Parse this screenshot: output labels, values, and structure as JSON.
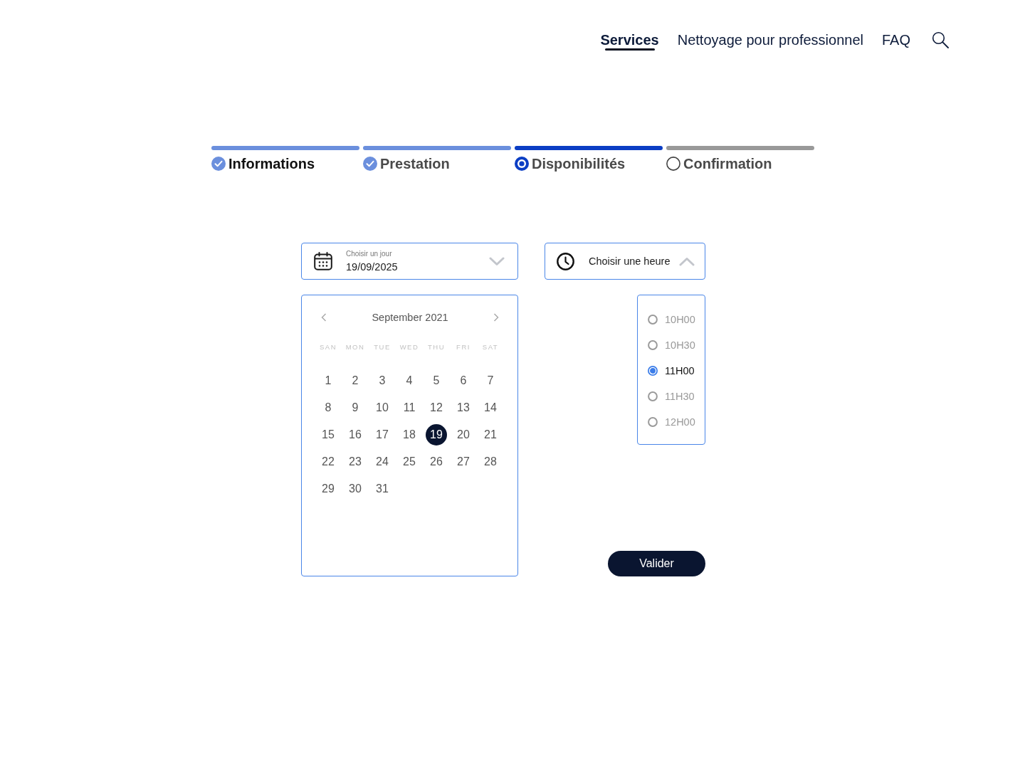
{
  "nav": {
    "items": [
      {
        "label": "Services",
        "selected": true
      },
      {
        "label": "Nettoyage pour professionnel",
        "selected": false
      },
      {
        "label": "FAQ",
        "selected": false
      }
    ]
  },
  "steps": [
    {
      "label": "Informations",
      "completed": true,
      "current": false,
      "emphasized": true
    },
    {
      "label": "Prestation",
      "completed": true,
      "current": false,
      "emphasized": false
    },
    {
      "label": "Disponibilités",
      "completed": false,
      "current": true,
      "emphasized": false
    },
    {
      "label": "Confirmation",
      "completed": false,
      "current": false,
      "emphasized": false
    }
  ],
  "date_field": {
    "label": "Choisir un jour",
    "value": "19/09/2025",
    "expanded": false
  },
  "time_field": {
    "label": "Choisir une heure",
    "expanded": true
  },
  "calendar": {
    "month": "September 2021",
    "weekdays": [
      "SAN",
      "MON",
      "TUE",
      "WED",
      "THU",
      "FRI",
      "SAT"
    ],
    "days": [
      {
        "label": "1",
        "selected": false
      },
      {
        "label": "2",
        "selected": false
      },
      {
        "label": "3",
        "selected": false
      },
      {
        "label": "4",
        "selected": false
      },
      {
        "label": "5",
        "selected": false
      },
      {
        "label": "6",
        "selected": false
      },
      {
        "label": "7",
        "selected": false
      },
      {
        "label": "8",
        "selected": false
      },
      {
        "label": "9",
        "selected": false
      },
      {
        "label": "10",
        "selected": false
      },
      {
        "label": "11",
        "selected": false
      },
      {
        "label": "12",
        "selected": false
      },
      {
        "label": "13",
        "selected": false
      },
      {
        "label": "14",
        "selected": false
      },
      {
        "label": "15",
        "selected": false
      },
      {
        "label": "16",
        "selected": false
      },
      {
        "label": "17",
        "selected": false
      },
      {
        "label": "18",
        "selected": false
      },
      {
        "label": "19",
        "selected": true
      },
      {
        "label": "20",
        "selected": false
      },
      {
        "label": "21",
        "selected": false
      },
      {
        "label": "22",
        "selected": false
      },
      {
        "label": "23",
        "selected": false
      },
      {
        "label": "24",
        "selected": false
      },
      {
        "label": "25",
        "selected": false
      },
      {
        "label": "26",
        "selected": false
      },
      {
        "label": "27",
        "selected": false
      },
      {
        "label": "28",
        "selected": false
      },
      {
        "label": "29",
        "selected": false
      },
      {
        "label": "30",
        "selected": false
      },
      {
        "label": "31",
        "selected": false
      }
    ]
  },
  "time_slots": [
    {
      "label": "10H00",
      "selected": false
    },
    {
      "label": "10H30",
      "selected": false
    },
    {
      "label": "11H00",
      "selected": true
    },
    {
      "label": "11H30",
      "selected": false
    },
    {
      "label": "12H00",
      "selected": false
    }
  ],
  "submit_button": {
    "label": "Valider"
  }
}
